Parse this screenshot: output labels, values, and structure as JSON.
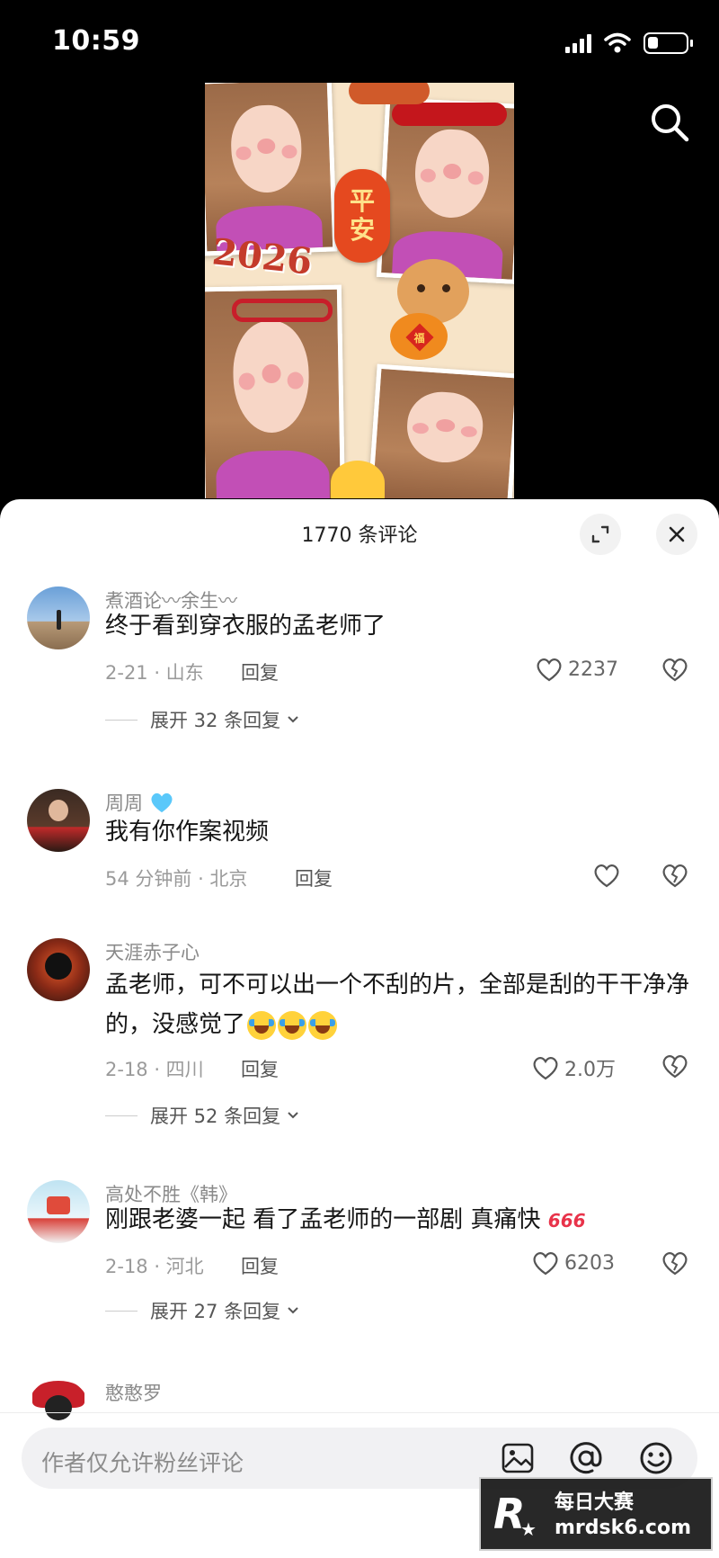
{
  "status_bar": {
    "time": "10:59",
    "battery_level": 0.3
  },
  "video": {
    "year_text": "2026",
    "banner_text_1": "平",
    "banner_text_2": "安",
    "fu_text": "福"
  },
  "panel": {
    "title": "1770 条评论"
  },
  "comments": [
    {
      "name": "煮酒论〰余生〰",
      "text": "终于看到穿衣服的孟老师了",
      "meta": "2-21 · 山东",
      "reply_label": "回复",
      "likes": "2237",
      "expand": "展开 32 条回复"
    },
    {
      "name": "周周",
      "text": "我有你作案视频",
      "meta": "54 分钟前 · 北京",
      "reply_label": "回复",
      "likes": "",
      "expand": ""
    },
    {
      "name": "天涯赤子心",
      "text": "孟老师，可不可以出一个不刮的片，全部是刮的干干净净的，没感觉了",
      "meta": "2-18 · 四川",
      "reply_label": "回复",
      "likes": "2.0万",
      "expand": "展开 52 条回复"
    },
    {
      "name": "高处不胜《韩》",
      "text": "刚跟老婆一起 看了孟老师的一部剧 真痛快",
      "badge": "666",
      "meta": "2-18 · 河北",
      "reply_label": "回复",
      "likes": "6203",
      "expand": "展开 27 条回复"
    },
    {
      "name": "憨憨罗"
    }
  ],
  "input": {
    "placeholder": "作者仅允许粉丝评论"
  },
  "watermark": {
    "logo": "R",
    "title": "每日大赛",
    "url": "mrdsk6.com"
  },
  "colors": {
    "panel_bg": "#ffffff",
    "heart_blue": "#5ac8fa",
    "accent_red": "#e8334a"
  }
}
